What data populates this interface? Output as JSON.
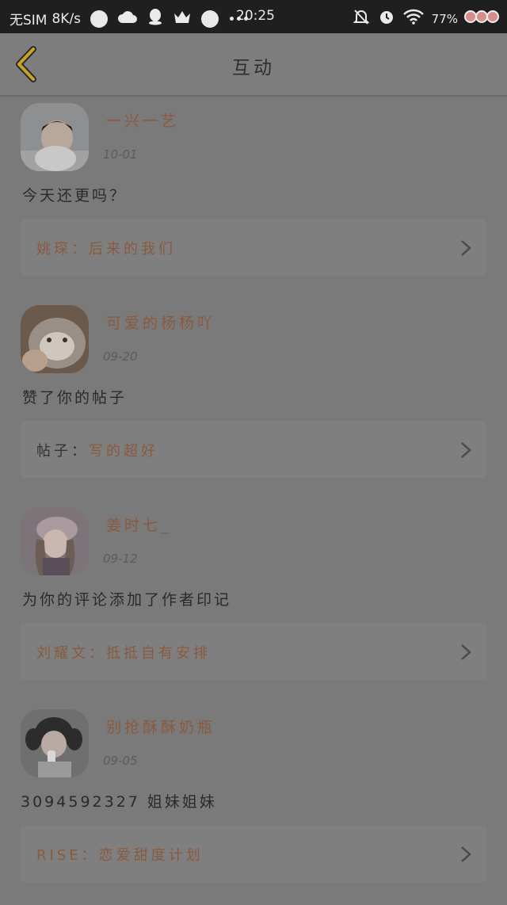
{
  "status_bar": {
    "carrier": "无SIM",
    "speed": "8K/s",
    "time": "20:25",
    "battery": "77%"
  },
  "header": {
    "title": "互动",
    "back_icon": "chevron-left-icon"
  },
  "items": [
    {
      "name": "一兴一艺",
      "date": "10-01",
      "message": "今天还更吗？",
      "card_prefix": "姚琛：",
      "card_title": "后来的我们"
    },
    {
      "name": "可爱的杨杨吖",
      "date": "09-20",
      "message": "赞了你的帖子",
      "card_prefix": "帖子：",
      "card_title": "写的超好"
    },
    {
      "name": "姜时七_",
      "date": "09-12",
      "message": "为你的评论添加了作者印记",
      "card_prefix": "刘耀文：",
      "card_title": "抵抵自有安排"
    },
    {
      "name": "别抢酥酥奶瓶",
      "date": "09-05",
      "message": "3094592327 姐妹姐妹",
      "card_prefix": "RISE：",
      "card_title": "恋爱甜度计划"
    }
  ],
  "colors": {
    "accent": "#8a5a3f",
    "back_icon": "#c9a227",
    "statusbar_bg": "#1f1f1f",
    "page_bg": "#7a7a7a"
  }
}
